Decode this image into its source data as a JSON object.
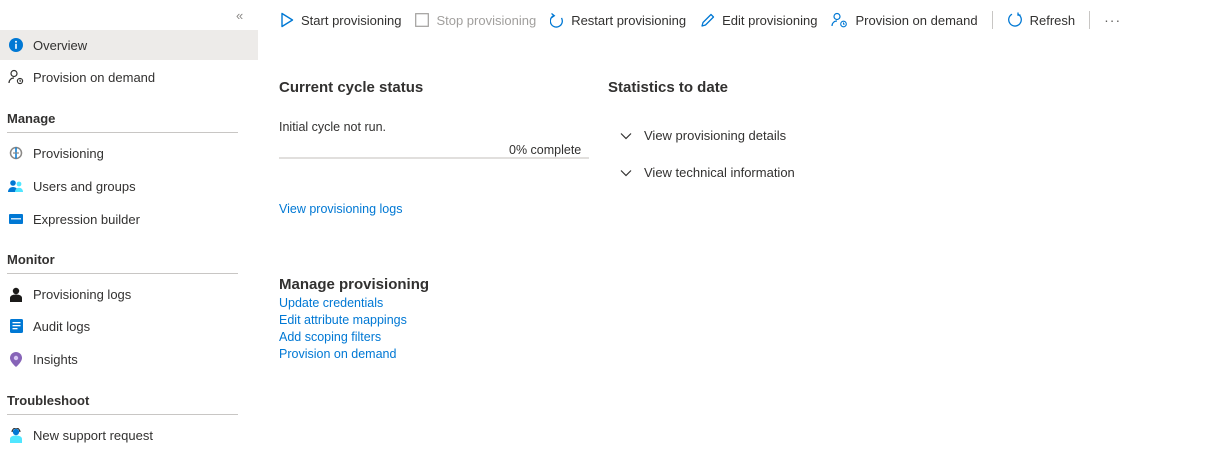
{
  "sidebar": {
    "collapse_glyph": "«",
    "items": [
      {
        "label": "Overview",
        "icon": "info-icon",
        "selected": true
      },
      {
        "label": "Provision on demand",
        "icon": "provision-on-demand-icon"
      }
    ],
    "sections": [
      {
        "title": "Manage",
        "items": [
          {
            "label": "Provisioning",
            "icon": "provisioning-icon"
          },
          {
            "label": "Users and groups",
            "icon": "users-groups-icon"
          },
          {
            "label": "Expression builder",
            "icon": "expression-builder-icon"
          }
        ]
      },
      {
        "title": "Monitor",
        "items": [
          {
            "label": "Provisioning logs",
            "icon": "provisioning-logs-icon"
          },
          {
            "label": "Audit logs",
            "icon": "audit-logs-icon"
          },
          {
            "label": "Insights",
            "icon": "insights-icon"
          }
        ]
      },
      {
        "title": "Troubleshoot",
        "items": [
          {
            "label": "New support request",
            "icon": "support-request-icon"
          }
        ]
      }
    ]
  },
  "toolbar": {
    "start": "Start provisioning",
    "stop": "Stop provisioning",
    "restart": "Restart provisioning",
    "edit": "Edit provisioning",
    "on_demand": "Provision on demand",
    "refresh": "Refresh",
    "more": "···"
  },
  "cycle": {
    "title": "Current cycle status",
    "status": "Initial cycle not run.",
    "progress_percent": 0,
    "progress_label": "0% complete",
    "logs_link": "View provisioning logs"
  },
  "stats": {
    "title": "Statistics to date",
    "details": "View provisioning details",
    "technical": "View technical information"
  },
  "manage": {
    "title": "Manage provisioning",
    "links": [
      "Update credentials",
      "Edit attribute mappings",
      "Add scoping filters",
      "Provision on demand"
    ]
  },
  "colors": {
    "accent": "#0078d4",
    "selected_bg": "#edebe9",
    "text": "#323130",
    "disabled": "#a19f9d"
  }
}
